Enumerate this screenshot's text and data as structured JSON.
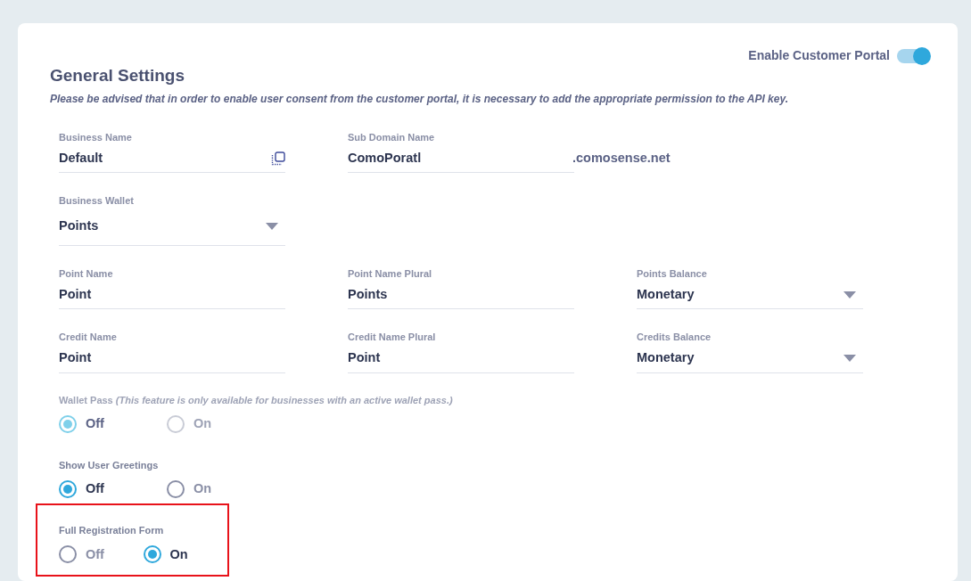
{
  "header": {
    "title": "General Settings",
    "note": "Please be advised that in order to enable user consent from the customer portal, it is necessary to add the appropriate permission to the API key.",
    "toggle": {
      "label": "Enable Customer Portal",
      "on": true
    }
  },
  "field_rows": [
    {
      "fields": [
        {
          "kind": "copy",
          "label": "Business Name",
          "value": "Default"
        },
        {
          "kind": "suffix",
          "label": "Sub Domain Name",
          "value": "ComoPoratl",
          "suffix": ".comosense.net"
        }
      ]
    },
    {
      "fields": [
        {
          "kind": "select",
          "label": "Business Wallet",
          "value": "Points"
        }
      ]
    },
    {
      "fields": [
        {
          "kind": "text",
          "label": "Point Name",
          "value": "Point"
        },
        {
          "kind": "text",
          "label": "Point Name Plural",
          "value": "Points"
        },
        {
          "kind": "select",
          "label": "Points Balance",
          "value": "Monetary"
        }
      ]
    },
    {
      "fields": [
        {
          "kind": "text",
          "label": "Credit Name",
          "value": "Point"
        },
        {
          "kind": "text",
          "label": "Credit Name Plural",
          "value": "Point"
        },
        {
          "kind": "select",
          "label": "Credits Balance",
          "value": "Monetary"
        }
      ]
    }
  ],
  "radio_groups": [
    {
      "label": "Wallet Pass *(This feature is only available for businesses with an active wallet pass.)*",
      "disabled": true,
      "highlighted": false,
      "options": [
        {
          "label": "Off",
          "selected": true
        },
        {
          "label": "On",
          "selected": false
        }
      ]
    },
    {
      "label": "Show User Greetings",
      "disabled": false,
      "highlighted": false,
      "options": [
        {
          "label": "Off",
          "selected": true
        },
        {
          "label": "On",
          "selected": false
        }
      ]
    },
    {
      "label": "Full Registration Form",
      "disabled": false,
      "highlighted": true,
      "options": [
        {
          "label": "Off",
          "selected": false
        },
        {
          "label": "On",
          "selected": true
        }
      ]
    }
  ]
}
